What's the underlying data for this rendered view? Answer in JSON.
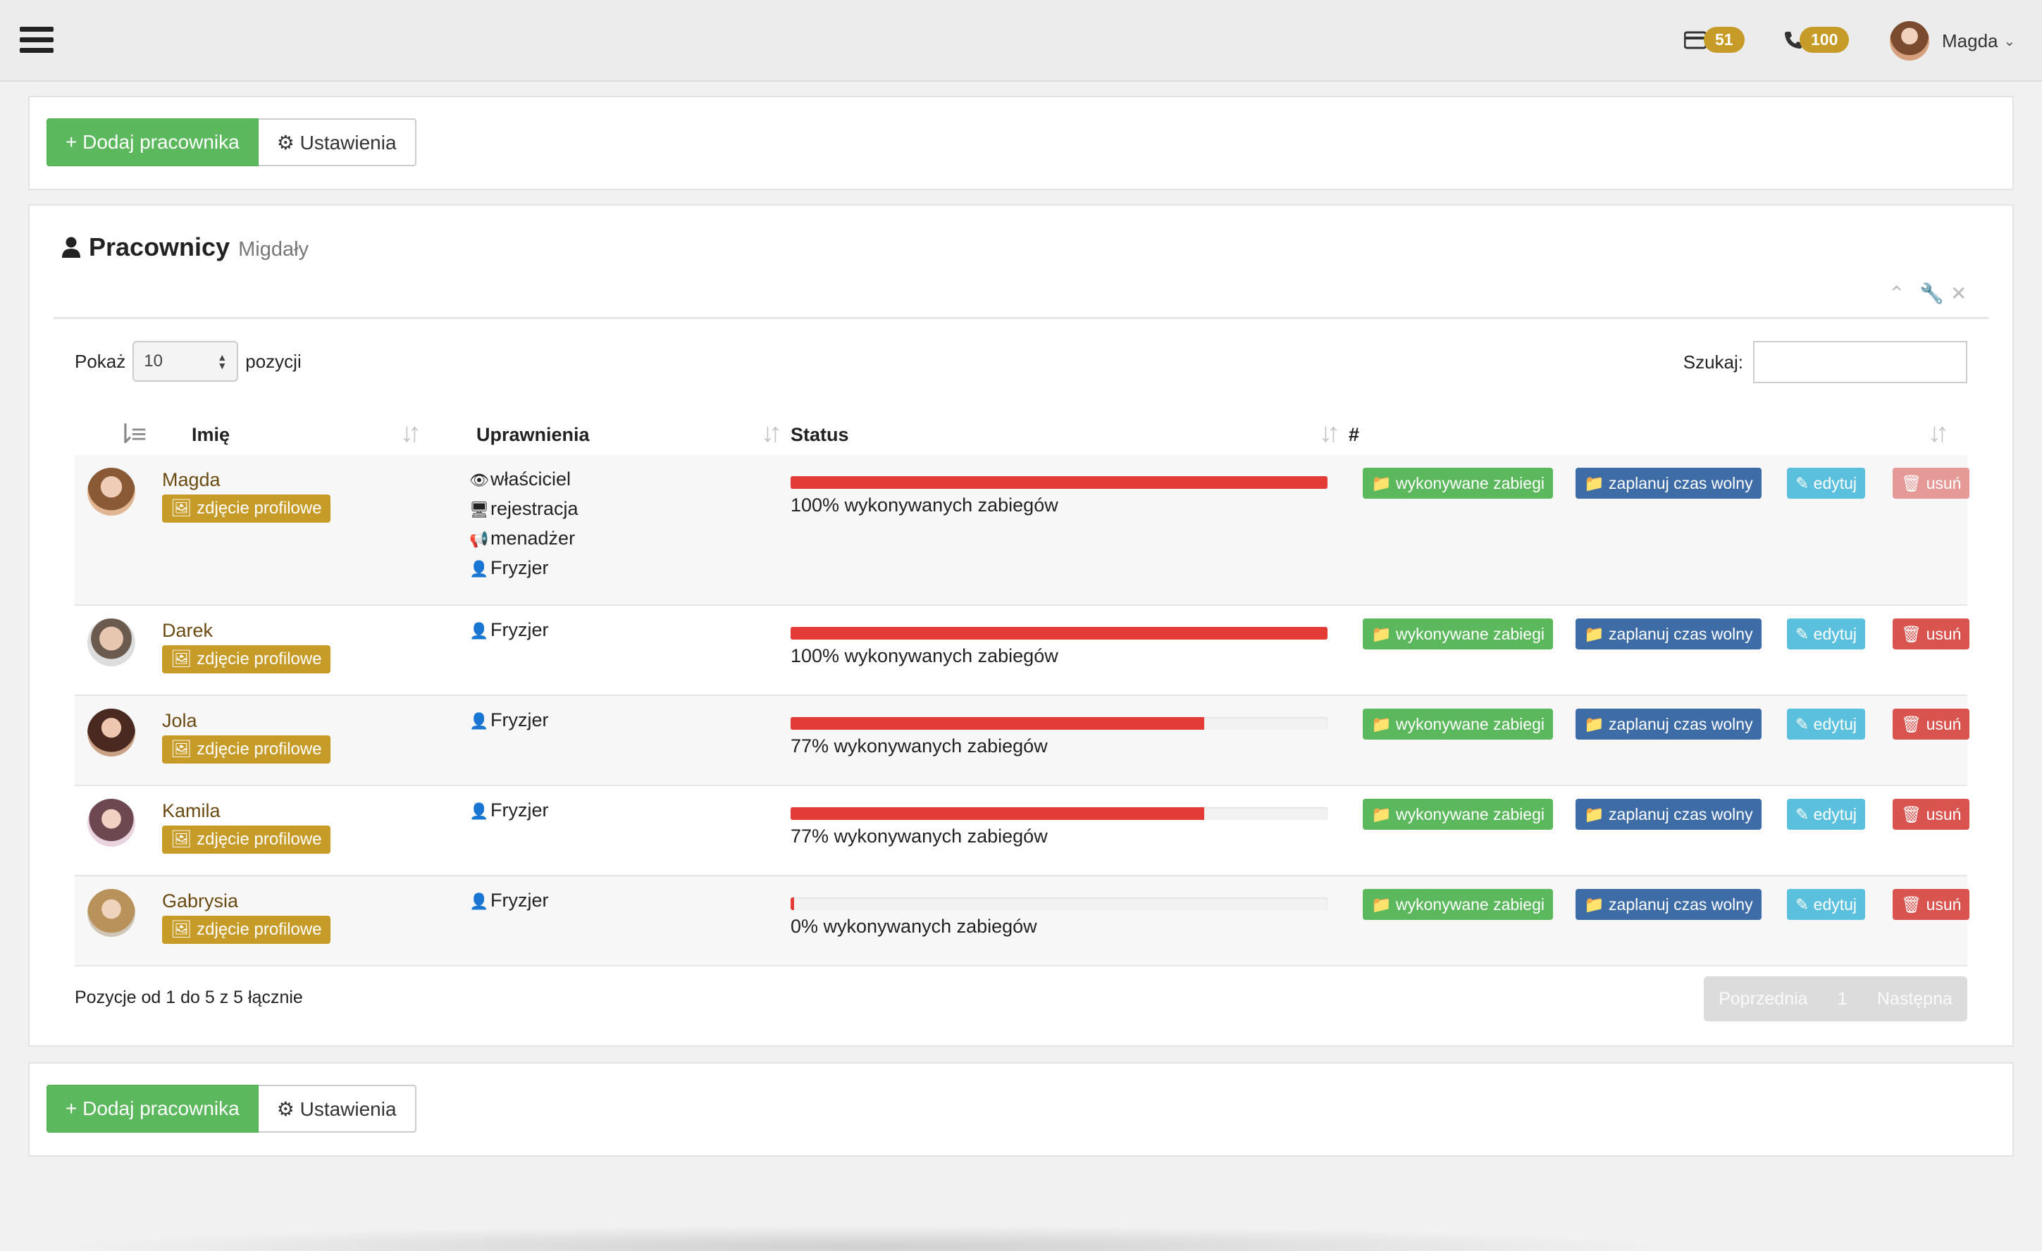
{
  "topbar": {
    "badges": [
      {
        "icon": "card-icon",
        "count": "51"
      },
      {
        "icon": "phone-icon",
        "count": "100"
      }
    ],
    "user_name": "Magda"
  },
  "actions": {
    "add_label": "+ Dodaj pracownika",
    "settings_label": "Ustawienia"
  },
  "panel": {
    "title": "Pracownicy",
    "subtitle": "Migdały"
  },
  "table_controls": {
    "show_label": "Pokaż",
    "show_value": "10",
    "show_suffix": "pozycji",
    "search_label": "Szukaj:"
  },
  "columns": [
    "Imię",
    "Uprawnienia",
    "Status",
    "#"
  ],
  "row_buttons": {
    "photo": "zdjęcie profilowe",
    "treatments": "wykonywane zabiegi",
    "timeoff": "zaplanuj czas wolny",
    "edit": "edytuj",
    "delete": "usuń"
  },
  "employees": [
    {
      "name": "Magda",
      "perms": [
        "właściciel",
        "rejestracja",
        "menadżer",
        "Fryzjer"
      ],
      "perm_icons": [
        "eye-icon",
        "monitor-icon",
        "megaphone-icon",
        "user-icon"
      ],
      "progress": 100,
      "status": "100% wykonywanych zabiegów"
    },
    {
      "name": "Darek",
      "perms": [
        "Fryzjer"
      ],
      "perm_icons": [
        "user-icon"
      ],
      "progress": 100,
      "status": "100% wykonywanych zabiegów"
    },
    {
      "name": "Jola",
      "perms": [
        "Fryzjer"
      ],
      "perm_icons": [
        "user-icon"
      ],
      "progress": 77,
      "status": "77% wykonywanych zabiegów"
    },
    {
      "name": "Kamila",
      "perms": [
        "Fryzjer"
      ],
      "perm_icons": [
        "user-icon"
      ],
      "progress": 77,
      "status": "77% wykonywanych zabiegów"
    },
    {
      "name": "Gabrysia",
      "perms": [
        "Fryzjer"
      ],
      "perm_icons": [
        "user-icon"
      ],
      "progress": 0,
      "status": "0% wykonywanych zabiegów"
    }
  ],
  "footer": {
    "info": "Pozycje od 1 do 5 z 5 łącznie",
    "prev": "Poprzednia",
    "page": "1",
    "next": "Następna"
  },
  "colors": {
    "accent_green": "#5cb85c",
    "badge_gold": "#c79b28",
    "progress_red": "#e33b36"
  }
}
